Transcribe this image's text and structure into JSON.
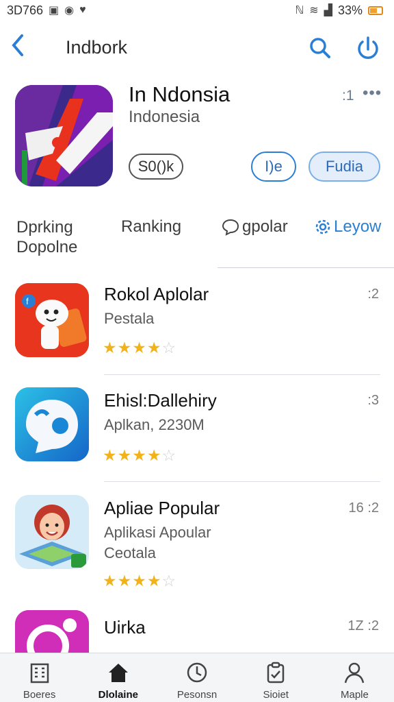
{
  "status_bar": {
    "left_text": "3D766",
    "battery": "33%"
  },
  "nav": {
    "title": "Indbork",
    "icons": [
      "back-chevron-icon",
      "search-icon",
      "power-icon"
    ]
  },
  "hero": {
    "title": "In Ndonsia",
    "subtitle": "Indonesia",
    "count": ":1",
    "more": "•••",
    "rating_badge": "S0()k",
    "button_outline": "I)e",
    "button_fill": "Fudia"
  },
  "tabs": [
    {
      "label_line1": "Dprking",
      "label_line2": "Dopolne"
    },
    {
      "label": "Ranking"
    },
    {
      "label": "gpolar",
      "icon": "chat-bubble-icon"
    },
    {
      "label": "Leyow",
      "icon": "gear-icon"
    }
  ],
  "apps": [
    {
      "title": "Rokol Aplolar",
      "line1": "Pestala",
      "line2": "",
      "meta": ":2",
      "rating": 4,
      "colors": {
        "bg": "#e8361e",
        "accent": "#f57a2a"
      }
    },
    {
      "title": "Ehisl:Dallehiry",
      "line1": "Aplkan, 2230M",
      "line2": "",
      "meta": ":3",
      "rating": 4,
      "colors": {
        "bg": "#1a87d6",
        "accent": "#2cb8e0"
      }
    },
    {
      "title": "Apliae Popular",
      "line1": "Aplikasi   Apoular",
      "line2": "Ceotala",
      "meta": "16 :2",
      "rating": 4,
      "colors": {
        "bg": "#cde8f7",
        "accent": "#d65a2e"
      }
    },
    {
      "title": "Uirka",
      "line1": "",
      "line2": "",
      "meta": "1Z :2",
      "rating": 0,
      "colors": {
        "bg": "#d02db8",
        "accent": "#f06fd8"
      }
    }
  ],
  "tabbar": [
    {
      "label": "Boeres",
      "icon": "grid-building-icon"
    },
    {
      "label": "Dlolaine",
      "icon": "home-icon",
      "active": true
    },
    {
      "label": "Pesonsn",
      "icon": "clock-icon"
    },
    {
      "label": "Sioiet",
      "icon": "clipboard-icon"
    },
    {
      "label": "Maple",
      "icon": "person-icon"
    }
  ]
}
